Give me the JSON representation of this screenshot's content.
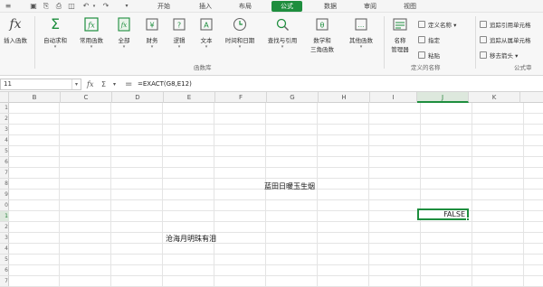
{
  "menu": {
    "tabs": [
      {
        "label": "开始"
      },
      {
        "label": "插入"
      },
      {
        "label": "布局"
      },
      {
        "label": "公式",
        "active": true
      },
      {
        "label": "数据"
      },
      {
        "label": "审阅"
      },
      {
        "label": "视图"
      }
    ]
  },
  "ribbon": {
    "insert_function": "插入函数",
    "autosum": "自动求和",
    "common_functions": "常用函数",
    "all": "全部",
    "financial": "财务",
    "logical": "逻辑",
    "text": "文本",
    "datetime": "时间和日期",
    "lookup": "查找与引用",
    "math_line1": "数学和",
    "math_line2": "三角函数",
    "other_functions": "其他函数",
    "function_library": "函数库",
    "name_manager_line1": "名称",
    "name_manager_line2": "管理器",
    "define_name": "定义名称",
    "specify": "指定",
    "paste": "粘贴",
    "defined_names": "定义的名称",
    "trace_precedents": "追踪引用单元格",
    "trace_dependents": "追踪从属单元格",
    "remove_arrows": "移去箭头",
    "formula_auditing": "公式审"
  },
  "formula_bar": {
    "name_box": "11",
    "fx_icon": "fx",
    "sigma_icon": "Σ",
    "equals_sign": "=",
    "formula": "=EXACT(G8,E12)"
  },
  "grid": {
    "columns": [
      "B",
      "C",
      "D",
      "E",
      "F",
      "G",
      "H",
      "I",
      "J",
      "K"
    ],
    "active_column": "J",
    "rows": [
      "1",
      "2",
      "3",
      "4",
      "5",
      "6",
      "7",
      "8",
      "9",
      "0",
      "1",
      "2",
      "3",
      "4",
      "5",
      "6",
      "7"
    ],
    "active_row_index": 10,
    "cell_g8": "蓝田日暖玉生烟",
    "cell_e12": "沧海月明珠有泪",
    "active_cell_value": "FALSE"
  },
  "colors": {
    "accent": "#1e8e3e"
  }
}
